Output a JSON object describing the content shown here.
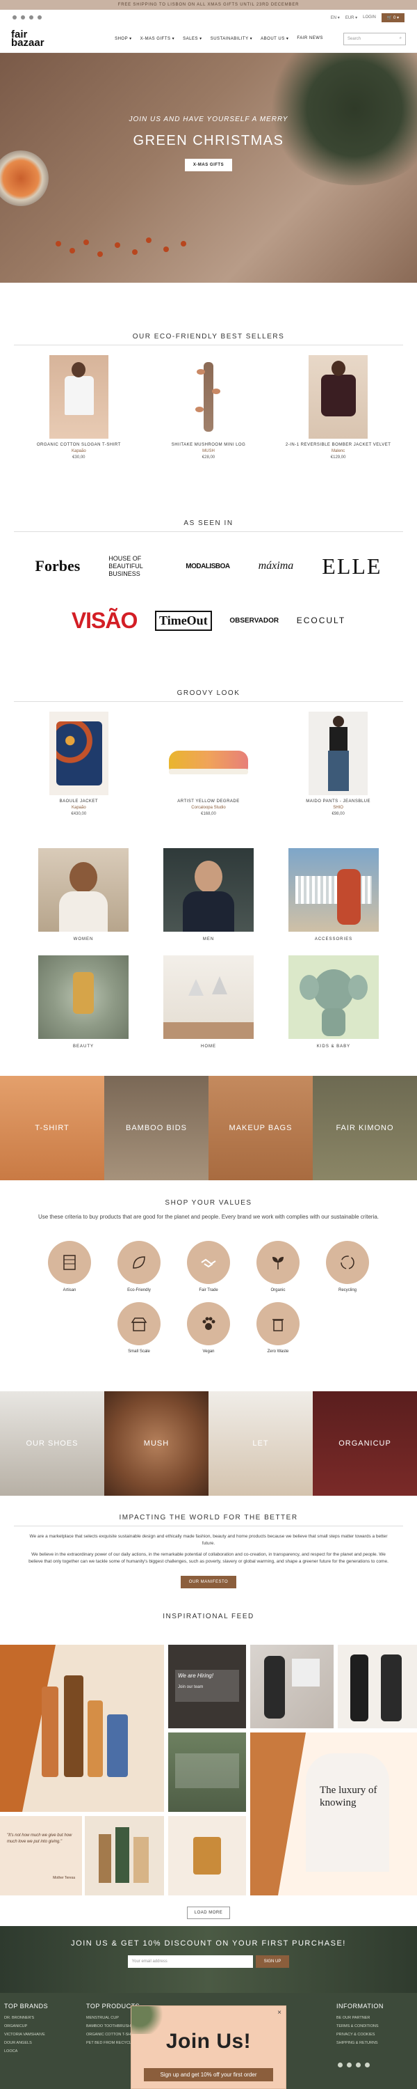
{
  "announcement": "FREE SHIPPING TO LISBON ON ALL XMAS GIFTS UNTIL 23RD DECEMBER",
  "utility": {
    "lang": "EN ▾",
    "currency": "EUR ▾",
    "login": "LOGIN",
    "cart": "0 ▾"
  },
  "brand": {
    "line1": "fair",
    "line2": "bazaar"
  },
  "nav": [
    "SHOP ▾",
    "X-MAS GIFTS ▾",
    "SALES ▾",
    "SUSTAINABILITY ▾",
    "ABOUT US ▾",
    "FAIR NEWS"
  ],
  "search": {
    "placeholder": "Search"
  },
  "hero": {
    "small": "JOIN US AND HAVE YOURSELF A MERRY",
    "big": "GREEN CHRISTMAS",
    "button": "X-MAS GIFTS"
  },
  "bestsellers": {
    "title": "OUR ECO-FRIENDLY BEST SELLERS",
    "items": [
      {
        "name": "ORGANIC COTTON SLOGAN T-SHIRT",
        "brand": "Kapaão",
        "price": "€30,00"
      },
      {
        "name": "SHIITAKE MUSHROOM MINI LOG",
        "brand": "MUSH",
        "price": "€28,00"
      },
      {
        "name": "2-IN-1 REVERSIBLE BOMBER JACKET VELVET",
        "brand": "Malenc",
        "price": "€129,00"
      }
    ]
  },
  "seen_in": {
    "title": "AS SEEN IN",
    "row1": [
      "Forbes",
      "HOUSE OF BEAUTIFUL BUSINESS",
      "MODALISBOA",
      "máxima",
      "ELLE"
    ],
    "row2": [
      "VISÃO",
      "TimeOut",
      "OBSERVADOR",
      "ECOCULT"
    ]
  },
  "groovy": {
    "title": "GROOVY LOOK",
    "items": [
      {
        "name": "BAOULE JACKET",
        "brand": "Kapaão",
        "price": "€430,00"
      },
      {
        "name": "ARTIST YELLOW DEGRADE",
        "brand": "Corcaloopa Studio",
        "price": "€168,00"
      },
      {
        "name": "MAIDO PANTS - JEANSBLUE",
        "brand": "SHIO",
        "price": "€98,00"
      }
    ]
  },
  "categories": {
    "row1": [
      "WOMEN",
      "MEN",
      "ACCESSORIES"
    ],
    "row2": [
      "BEAUTY",
      "HOME",
      "KIDS & BABY"
    ]
  },
  "strip1": [
    "T-SHIRT",
    "BAMBOO BIDS",
    "MAKEUP BAGS",
    "FAIR KIMONO"
  ],
  "values": {
    "title": "SHOP YOUR VALUES",
    "intro": "Use these criteria to buy products that are good for the planet and people. Every brand we work with complies with our sustainable criteria.",
    "row1": [
      "Artisan",
      "Eco-Friendly",
      "Fair Trade",
      "Organic",
      "Recycling"
    ],
    "row2": [
      "Small Scale",
      "Vegan",
      "Zero Waste"
    ]
  },
  "strip2": [
    "OUR SHOES",
    "MUSH",
    "LET",
    "ORGANICUP"
  ],
  "impact": {
    "title": "IMPACTING THE WORLD FOR THE BETTER",
    "p1": "We are a marketplace that selects exquisite sustainable design and ethically made fashion, beauty and home products because we believe that small steps matter towards a better future.",
    "p2": "We believe in the extraordinary power of our daily actions, in the remarkable potential of collaboration and co-creation, in transparency, and respect for the planet and people. We believe that only together can we tackle some of humanity's biggest challenges, such as poverty, slavery or global warming, and shape a greener future for the generations to come.",
    "button": "OUR MANIFESTO"
  },
  "feed": {
    "title": "INSPIRATIONAL FEED",
    "tile_texts": [
      "We are Hiring!",
      "Join our team",
      "The luxury of knowing",
      "\"It's not how much we give but how much love we put into giving.\"",
      "Mother Teresa"
    ],
    "load_more": "LOAD MORE"
  },
  "newsletter": {
    "head": "JOIN US & GET 10% DISCOUNT ON YOUR FIRST PURCHASE!",
    "placeholder": "Your email address",
    "button": "SIGN UP"
  },
  "footer": {
    "top_brands": {
      "title": "TOP BRANDS",
      "items": [
        "DR. BRONNER'S",
        "ORGANICUP",
        "VICTORIA VAMSHAIVE",
        "DOUR ANGELS",
        "LOOCA"
      ]
    },
    "top_products": {
      "title": "TOP PRODUCTS",
      "items": [
        "MENSTRUAL CUP",
        "BAMBOO TOOTHBRUSH",
        "ORGANIC COTTON T-SHIRT",
        "PET BED FROM RECYCLED TEXTILES"
      ]
    },
    "information": {
      "title": "INFORMATION",
      "items": [
        "BE OUR PARTNER",
        "TERMS & CONDITIONS",
        "PRIVACY & COOKIES",
        "SHIPPING & RETURNS"
      ]
    }
  },
  "popup": {
    "title": "Join Us!",
    "offer": "Sign up and get 10% off your first order",
    "close": "×"
  },
  "colors": {
    "accent": "#8b5e3c",
    "announce_bg": "#c9b3a3",
    "value_circle": "#d8b79c",
    "footer_bg": "#3d4a3a"
  }
}
